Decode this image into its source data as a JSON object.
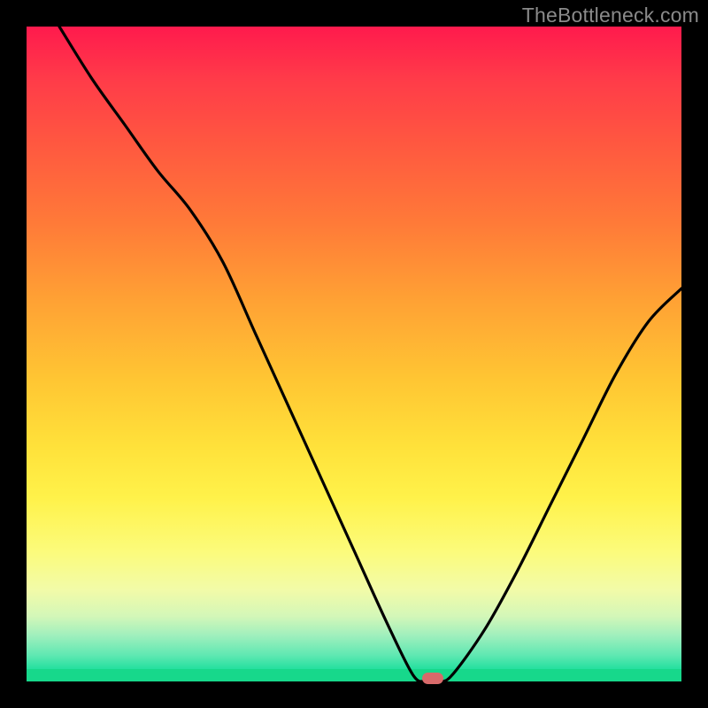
{
  "watermark": "TheBottleneck.com",
  "colors": {
    "background": "#000000",
    "watermark": "#8a8a8a",
    "curve": "#000000",
    "marker": "#d86a6a",
    "green": "#17d88b"
  },
  "chart_data": {
    "type": "line",
    "title": "",
    "xlabel": "",
    "ylabel": "",
    "xlim": [
      0,
      100
    ],
    "ylim": [
      0,
      100
    ],
    "grid": false,
    "series": [
      {
        "name": "bottleneck-curve",
        "x": [
          5,
          10,
          15,
          20,
          25,
          30,
          35,
          40,
          45,
          50,
          55,
          59,
          61,
          63,
          65,
          70,
          75,
          80,
          85,
          90,
          95,
          100
        ],
        "y": [
          100,
          92,
          85,
          78,
          72,
          64,
          53,
          42,
          31,
          20,
          9,
          1,
          0,
          0,
          1,
          8,
          17,
          27,
          37,
          47,
          55,
          60
        ]
      }
    ],
    "marker": {
      "x": 62,
      "y": 0
    },
    "gradient_stops": [
      {
        "pos": 0.0,
        "color": "#ff1a4d"
      },
      {
        "pos": 0.3,
        "color": "#ff7a38"
      },
      {
        "pos": 0.6,
        "color": "#ffe13a"
      },
      {
        "pos": 0.85,
        "color": "#f2fba8"
      },
      {
        "pos": 1.0,
        "color": "#10d890"
      }
    ]
  }
}
